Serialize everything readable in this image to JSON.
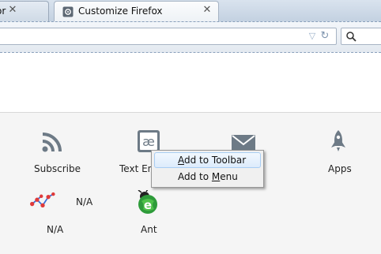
{
  "tabs": [
    {
      "label": "or",
      "close_glyph": "✕"
    },
    {
      "label": "Customize Firefox",
      "close_glyph": "✕"
    }
  ],
  "navbar": {
    "star_glyph": "▽",
    "reload_glyph": "↻"
  },
  "palette": {
    "items": [
      {
        "label": "Subscribe",
        "icon": "rss-feed-icon"
      },
      {
        "label": "Text Enc",
        "icon": "text-encoding-icon"
      },
      {
        "label": "",
        "icon": "email-link-icon"
      },
      {
        "label": "Apps",
        "icon": "rocket-apps-icon"
      },
      {
        "label": "N/A",
        "icon": "network-graph-icon",
        "side_label": "N/A"
      },
      {
        "label": "Ant",
        "icon": "ant-globe-icon"
      }
    ]
  },
  "context_menu": {
    "items": [
      {
        "pre": "",
        "accel": "A",
        "post": "dd to Toolbar",
        "highlighted": true
      },
      {
        "pre": "Add to ",
        "accel": "M",
        "post": "enu",
        "highlighted": false
      }
    ]
  },
  "colors": {
    "tabstrip": "#c8d5e4",
    "palette_bg": "#f5f5f5",
    "menu_highlight_border": "#a8cdf3",
    "icon_gray": "#6d7a86"
  }
}
